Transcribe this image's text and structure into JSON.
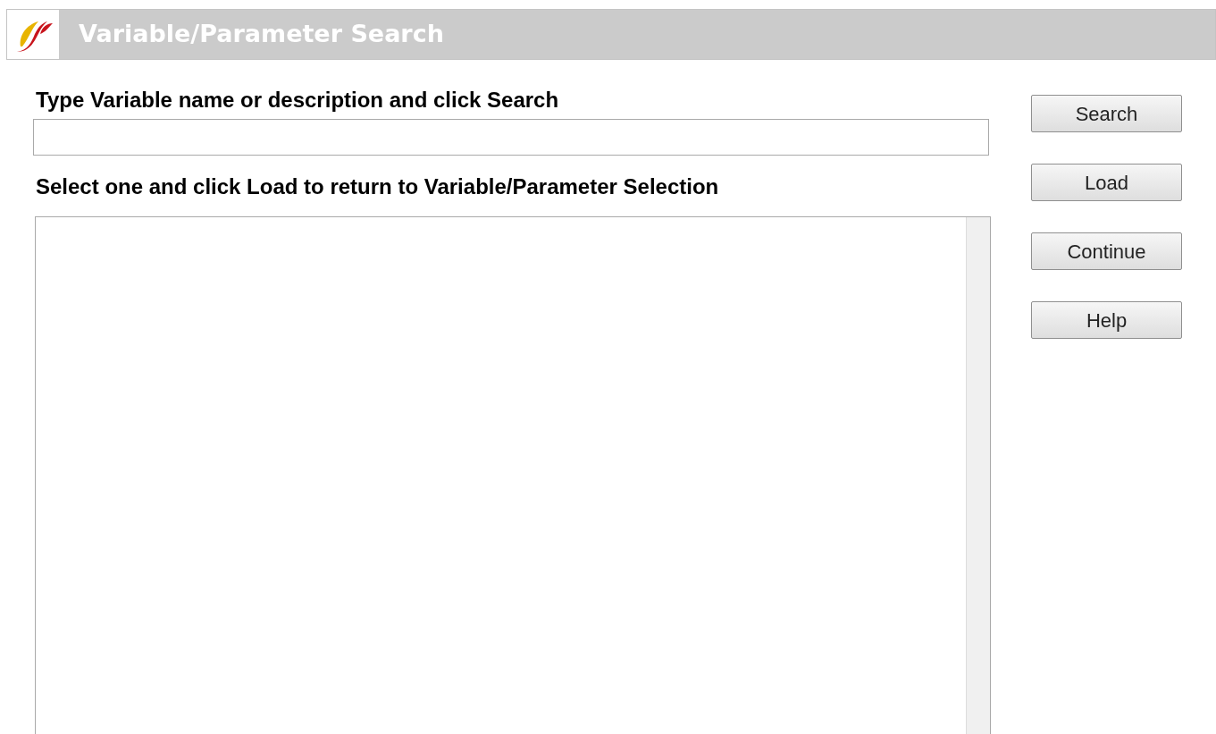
{
  "window": {
    "title": "Variable/Parameter Search"
  },
  "search": {
    "label": "Type Variable name or description and click Search"
  },
  "results": {
    "label": "Select one and click Load to return to Variable/Parameter Selection"
  },
  "buttons": [
    "Search",
    "Load",
    "Continue",
    "Help"
  ]
}
